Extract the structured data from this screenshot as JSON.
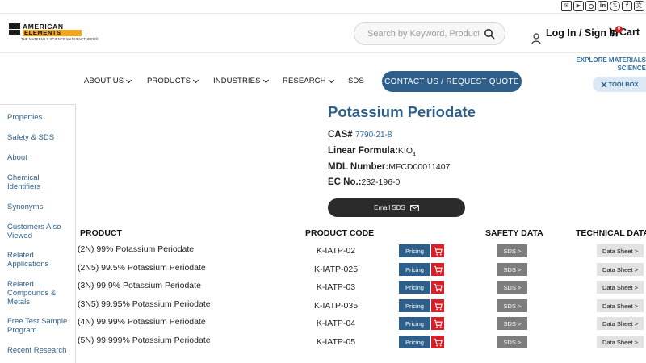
{
  "header": {
    "brand_top": "AMERICAN",
    "brand_bottom": "ELEMENTS",
    "tagline": "THE MATERIALS SCIENCE MANUFACTURER®",
    "search_placeholder": "Search by Keyword, Product, CAS...",
    "login_label": "Log In / Sign In",
    "cart_label": "Cart",
    "cart_count": "0",
    "social_icons": [
      "email-icon",
      "youtube-icon",
      "instagram-icon",
      "linkedin-icon",
      "x-twitter-icon",
      "facebook-icon",
      "translate-icon"
    ]
  },
  "nav": {
    "items": [
      "ABOUT US",
      "PRODUCTS",
      "INDUSTRIES",
      "RESEARCH",
      "SDS"
    ],
    "contact_label": "CONTACT US / REQUEST QUOTE",
    "explore_label": "EXPLORE MATERIALS SCIENCE",
    "toolbox_label": "TOOLBOX"
  },
  "sidebar": {
    "items": [
      "Properties",
      "Safety & SDS",
      "About",
      "Chemical Identifiers",
      "Synonyms",
      "Customers Also Viewed",
      "Related Applications",
      "Related Compounds & Metals",
      "Free Test Sample Program",
      "Recent Research"
    ]
  },
  "product": {
    "title": "Potassium Periodate",
    "cas_label": "CAS#",
    "cas_value": "7790-21-8",
    "formula_label": "Linear Formula:",
    "formula_value": "KIO",
    "formula_sub": "4",
    "mdl_label": "MDL Number:",
    "mdl_value": "MFCD00011407",
    "ec_label": "EC No.:",
    "ec_value": "232-196-0",
    "email_sds_label": "Email SDS"
  },
  "table": {
    "headers": {
      "product": "PRODUCT",
      "code": "PRODUCT CODE",
      "safety": "SAFETY DATA",
      "technical": "TECHNICAL DATA"
    },
    "pricing_label": "Pricing",
    "sds_label": "SDS >",
    "datasheet_label": "Data Sheet >",
    "rows": [
      {
        "name": "(2N) 99% Potassium Periodate",
        "code": "K-IATP-02"
      },
      {
        "name": "(2N5) 99.5% Potassium Periodate",
        "code": "K-IATP-025"
      },
      {
        "name": "(3N) 99.9% Potassium Periodate",
        "code": "K-IATP-03"
      },
      {
        "name": "(3N5) 99.95% Potassium Periodate",
        "code": "K-IATP-035"
      },
      {
        "name": "(4N) 99.99% Potassium Periodate",
        "code": "K-IATP-04"
      },
      {
        "name": "(5N) 99.999% Potassium Periodate",
        "code": "K-IATP-05"
      }
    ]
  }
}
